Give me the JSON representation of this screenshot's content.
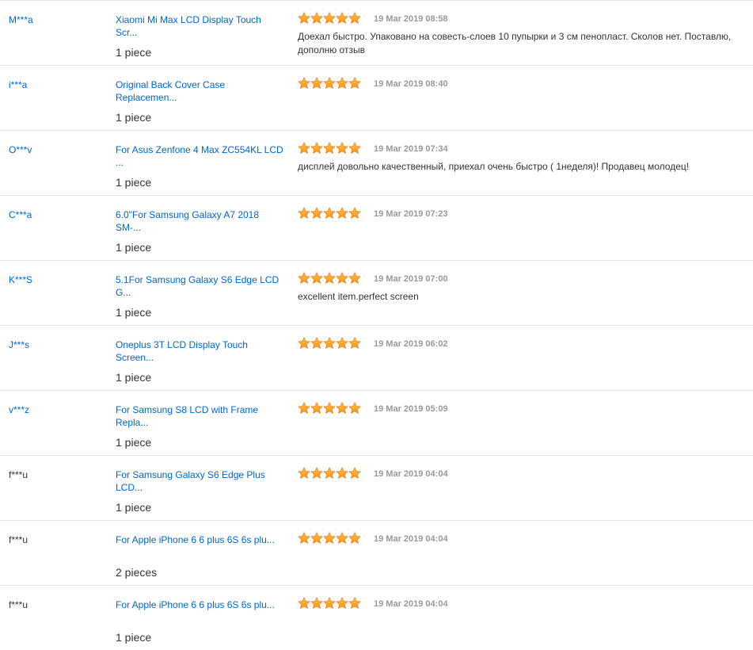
{
  "colors": {
    "link": "#0066cc",
    "text": "#333333",
    "date": "#999999",
    "star": "#f7931e",
    "divider": "#e6e6e6"
  },
  "rating_icon": "star-icon",
  "feedback": [
    {
      "buyer": "M***a",
      "buyer_linked": true,
      "product": "Xiaomi Mi Max LCD Display Touch Scr...",
      "quantity": "1 piece",
      "rating": 5,
      "date": "19 Mar 2019 08:58",
      "comment": "Доехал быстро. Упаковано на совесть-слоев 10 пупырки и 3 см пенопласт. Сколов нет. Поставлю, дополню отзыв"
    },
    {
      "buyer": "i***a",
      "buyer_linked": true,
      "product": "Original Back Cover Case Replacemen...",
      "quantity": "1 piece",
      "rating": 5,
      "date": "19 Mar 2019 08:40",
      "comment": ""
    },
    {
      "buyer": "O***v",
      "buyer_linked": true,
      "product": "For Asus Zenfone 4 Max ZC554KL LCD ...",
      "quantity": "1 piece",
      "rating": 5,
      "date": "19 Mar 2019 07:34",
      "comment": "дисплей довольно качественный, приехал очень быстро ( 1неделя)! Продавец молодец!"
    },
    {
      "buyer": "C***a",
      "buyer_linked": true,
      "product": "6.0\"For Samsung Galaxy A7 2018 SM-...",
      "quantity": "1 piece",
      "rating": 5,
      "date": "19 Mar 2019 07:23",
      "comment": ""
    },
    {
      "buyer": "K***S",
      "buyer_linked": true,
      "product": "5.1For Samsung Galaxy S6 Edge LCD G...",
      "quantity": "1 piece",
      "rating": 5,
      "date": "19 Mar 2019 07:00",
      "comment": "excellent item.perfect screen"
    },
    {
      "buyer": "J***s",
      "buyer_linked": true,
      "product": "Oneplus 3T LCD Display Touch Screen...",
      "quantity": "1 piece",
      "rating": 5,
      "date": "19 Mar 2019 06:02",
      "comment": ""
    },
    {
      "buyer": "v***z",
      "buyer_linked": true,
      "product": "For Samsung S8 LCD with Frame Repla...",
      "quantity": "1 piece",
      "rating": 5,
      "date": "19 Mar 2019 05:09",
      "comment": ""
    },
    {
      "buyer": "f***u",
      "buyer_linked": false,
      "product": "For Samsung Galaxy S6 Edge Plus LCD...",
      "quantity": "1 piece",
      "rating": 5,
      "date": "19 Mar 2019 04:04",
      "comment": ""
    },
    {
      "buyer": "f***u",
      "buyer_linked": false,
      "product": "For Apple iPhone 6 6 plus 6S 6s plu...",
      "quantity": "2 pieces",
      "rating": 5,
      "date": "19 Mar 2019 04:04",
      "comment": ""
    },
    {
      "buyer": "f***u",
      "buyer_linked": false,
      "product": "For Apple iPhone 6 6 plus 6S 6s plu...",
      "quantity": "1 piece",
      "rating": 5,
      "date": "19 Mar 2019 04:04",
      "comment": ""
    }
  ]
}
